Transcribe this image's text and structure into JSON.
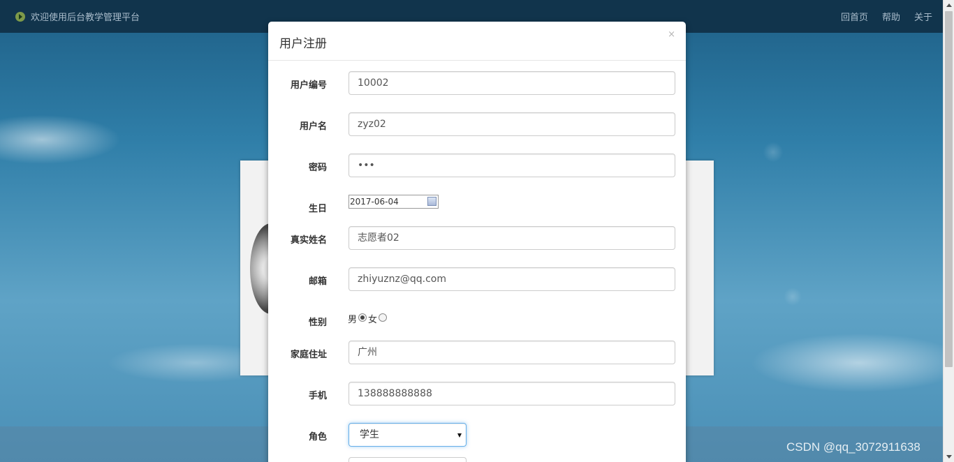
{
  "topbar": {
    "welcome": "欢迎使用后台教学管理平台",
    "nav": [
      "回首页",
      "帮助",
      "关于"
    ]
  },
  "modal": {
    "title": "用户注册",
    "close": "×",
    "fields": {
      "user_id": {
        "label": "用户编号",
        "value": "10002"
      },
      "username": {
        "label": "用户名",
        "value": "zyz02"
      },
      "password": {
        "label": "密码",
        "value": "•••"
      },
      "birthday": {
        "label": "生日",
        "value": "2017-06-04"
      },
      "realname": {
        "label": "真实姓名",
        "value": "志愿者02"
      },
      "email": {
        "label": "邮箱",
        "value": "zhiyuznz@qq.com"
      },
      "gender": {
        "label": "性别",
        "options": [
          "男",
          "女"
        ],
        "selected": "男"
      },
      "address": {
        "label": "家庭住址",
        "value": "广州"
      },
      "phone": {
        "label": "手机",
        "value": "138888888888"
      },
      "role": {
        "label": "角色",
        "value": "学生"
      }
    }
  },
  "watermark": "CSDN @qq_3072911638"
}
